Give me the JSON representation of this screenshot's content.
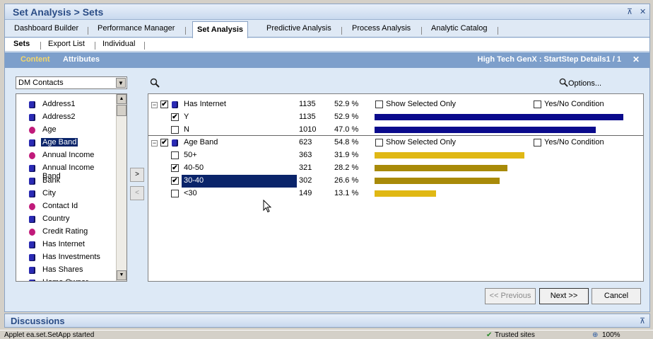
{
  "window": {
    "title": "Set Analysis > Sets"
  },
  "tabs": [
    "Dashboard Builder",
    "Performance Manager",
    "Set Analysis",
    "Predictive Analysis",
    "Process Analysis",
    "Analytic Catalog"
  ],
  "subtabs": [
    "Sets",
    "Export List",
    "Individual"
  ],
  "bluebar": {
    "content": "Content",
    "attributes": "Attributes",
    "context": "High Tech GenX : StartStep Details1 / 1",
    "close": "✕"
  },
  "combo": {
    "value": "DM Contacts"
  },
  "attributes": [
    {
      "label": "Address1",
      "type": "dim"
    },
    {
      "label": "Address2",
      "type": "dim"
    },
    {
      "label": "Age",
      "type": "meas"
    },
    {
      "label": "Age Band",
      "type": "dim",
      "selected": true
    },
    {
      "label": "Annual Income",
      "type": "meas"
    },
    {
      "label": "Annual Income Band",
      "type": "dim"
    },
    {
      "label": "Bank",
      "type": "dim"
    },
    {
      "label": "City",
      "type": "dim"
    },
    {
      "label": "Contact Id",
      "type": "meas"
    },
    {
      "label": "Country",
      "type": "dim"
    },
    {
      "label": "Credit Rating",
      "type": "meas"
    },
    {
      "label": "Has Internet",
      "type": "dim"
    },
    {
      "label": "Has Investments",
      "type": "dim"
    },
    {
      "label": "Has Shares",
      "type": "dim"
    },
    {
      "label": "Home Owner",
      "type": "dim"
    }
  ],
  "move_buttons": {
    "add": ">",
    "remove": "<"
  },
  "options_label": "Options...",
  "groups": [
    {
      "label": "Has Internet",
      "count": "1135",
      "pct": "52.9 %",
      "show_selected": "Show Selected Only",
      "yesno": "Yes/No Condition",
      "rows": [
        {
          "label": "Y",
          "count": "1135",
          "pct": "52.9 %",
          "checked": true,
          "fraction": 0.529,
          "color": "#0a0a8c"
        },
        {
          "label": "N",
          "count": "1010",
          "pct": "47.0 %",
          "checked": false,
          "fraction": 0.47,
          "color": "#0a0a8c"
        }
      ]
    },
    {
      "label": "Age Band",
      "count": "623",
      "pct": "54.8 %",
      "show_selected": "Show Selected Only",
      "yesno": "Yes/No Condition",
      "rows": [
        {
          "label": "50+",
          "count": "363",
          "pct": "31.9 %",
          "checked": false,
          "fraction": 0.319,
          "color": "#e0b814"
        },
        {
          "label": "40-50",
          "count": "321",
          "pct": "28.2 %",
          "checked": true,
          "fraction": 0.282,
          "color": "#a88a08"
        },
        {
          "label": "30-40",
          "count": "302",
          "pct": "26.6 %",
          "checked": true,
          "fraction": 0.266,
          "color": "#a88a08",
          "selected": true
        },
        {
          "label": "<30",
          "count": "149",
          "pct": "13.1 %",
          "checked": false,
          "fraction": 0.131,
          "color": "#e0b814"
        }
      ]
    }
  ],
  "footer": {
    "previous": "<< Previous",
    "next": "Next >>",
    "cancel": "Cancel"
  },
  "discussions": "Discussions",
  "status": {
    "left": "Applet ea.set.SetApp started",
    "zone": "Trusted sites",
    "zoom": "100%"
  }
}
